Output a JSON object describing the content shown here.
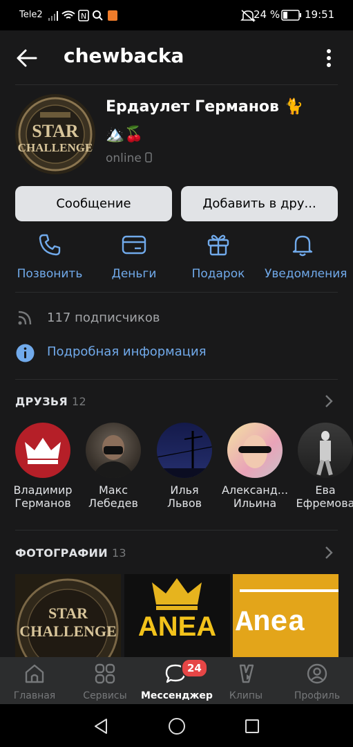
{
  "status_bar": {
    "carrier": "Tele2",
    "battery": "24 %",
    "time": "19:51"
  },
  "header": {
    "title": "chewbacka"
  },
  "profile": {
    "name": "Ердаулет Германов 🐈",
    "emoji_line": "🏔️🍒",
    "status": "online",
    "avatar_text_1": "STAR",
    "avatar_text_2": "CHALLENGE"
  },
  "buttons": {
    "message": "Сообщение",
    "add_friend": "Добавить в дру..."
  },
  "actions": [
    {
      "label": "Позвонить",
      "icon": "phone-icon"
    },
    {
      "label": "Деньги",
      "icon": "money-icon"
    },
    {
      "label": "Подарок",
      "icon": "gift-icon"
    },
    {
      "label": "Уведомления",
      "icon": "bell-icon"
    }
  ],
  "info": {
    "subscribers": "117 подписчиков",
    "details": "Подробная информация"
  },
  "friends": {
    "title": "ДРУЗЬЯ",
    "count": "12",
    "items": [
      {
        "first": "Владимир",
        "last": "Германов"
      },
      {
        "first": "Макс",
        "last": "Лебедев"
      },
      {
        "first": "Илья",
        "last": "Львов"
      },
      {
        "first": "Александ...",
        "last": "Ильина"
      },
      {
        "first": "Ева",
        "last": "Ефремова"
      }
    ]
  },
  "photos": {
    "title": "ФОТОГРАФИИ",
    "count": "13",
    "items": [
      {
        "caption": "STAR CHALLENGE"
      },
      {
        "caption": "ANEA"
      },
      {
        "caption": "Anea"
      }
    ]
  },
  "tabbar": {
    "items": [
      {
        "label": "Главная"
      },
      {
        "label": "Сервисы"
      },
      {
        "label": "Мессенджер"
      },
      {
        "label": "Клипы"
      },
      {
        "label": "Профиль"
      }
    ],
    "messenger_badge": "24"
  },
  "colors": {
    "accent": "#71aaeb",
    "background": "#19191a",
    "badge": "#e64646"
  }
}
